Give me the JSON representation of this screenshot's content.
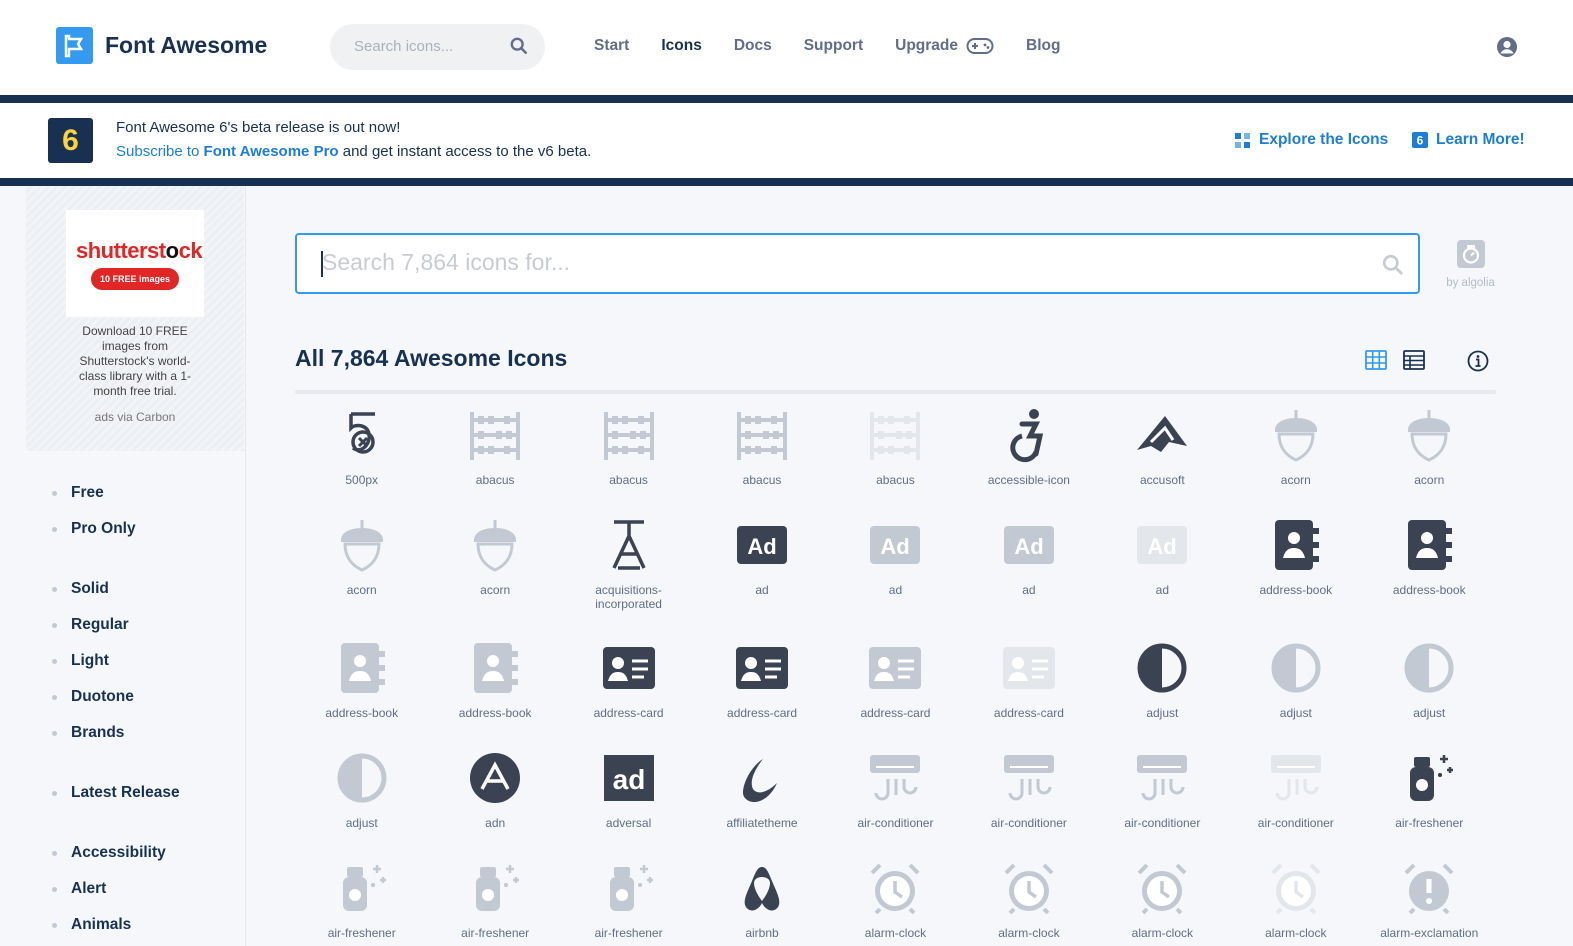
{
  "header": {
    "brand": "Font Awesome",
    "search_placeholder": "Search icons...",
    "nav": [
      "Start",
      "Icons",
      "Docs",
      "Support",
      "Upgrade",
      "Blog"
    ],
    "active_nav": "Icons"
  },
  "banner": {
    "badge": "6",
    "line1": "Font Awesome 6's beta release is out now!",
    "line2_link_a": "Subscribe to ",
    "line2_link_b": "Font Awesome Pro",
    "line2_rest": " and get instant access to the v6 beta.",
    "explore": "Explore the Icons",
    "learn": "Learn More!"
  },
  "ad": {
    "logo_a": "shutterst",
    "logo_b": "ck",
    "pill": "10 FREE images",
    "text": "Download 10 FREE images from Shutterstock's world-class library with a 1-month free trial.",
    "via": "ads via Carbon"
  },
  "filters": [
    "Free",
    "Pro Only",
    "Solid",
    "Regular",
    "Light",
    "Duotone",
    "Brands",
    "Latest Release",
    "Accessibility",
    "Alert",
    "Animals"
  ],
  "main": {
    "search_placeholder": "Search 7,864 icons for...",
    "algolia": "by algolia",
    "title": "All 7,864 Awesome Icons"
  },
  "icons": [
    {
      "label": "500px",
      "style": "dark"
    },
    {
      "label": "abacus",
      "style": "light"
    },
    {
      "label": "abacus",
      "style": "light"
    },
    {
      "label": "abacus",
      "style": "light"
    },
    {
      "label": "abacus",
      "style": "pale"
    },
    {
      "label": "accessible-icon",
      "style": "dark"
    },
    {
      "label": "accusoft",
      "style": "dark"
    },
    {
      "label": "acorn",
      "style": "light"
    },
    {
      "label": "acorn",
      "style": "light"
    },
    {
      "label": "acorn",
      "style": "light"
    },
    {
      "label": "acorn",
      "style": "light"
    },
    {
      "label": "acquisitions-incorporated",
      "style": "dark"
    },
    {
      "label": "ad",
      "style": "dark"
    },
    {
      "label": "ad",
      "style": "light"
    },
    {
      "label": "ad",
      "style": "light"
    },
    {
      "label": "ad",
      "style": "pale"
    },
    {
      "label": "address-book",
      "style": "dark"
    },
    {
      "label": "address-book",
      "style": "dark"
    },
    {
      "label": "address-book",
      "style": "light"
    },
    {
      "label": "address-book",
      "style": "light"
    },
    {
      "label": "address-card",
      "style": "dark"
    },
    {
      "label": "address-card",
      "style": "dark"
    },
    {
      "label": "address-card",
      "style": "light"
    },
    {
      "label": "address-card",
      "style": "pale"
    },
    {
      "label": "adjust",
      "style": "dark"
    },
    {
      "label": "adjust",
      "style": "light"
    },
    {
      "label": "adjust",
      "style": "light"
    },
    {
      "label": "adjust",
      "style": "light"
    },
    {
      "label": "adn",
      "style": "dark"
    },
    {
      "label": "adversal",
      "style": "dark"
    },
    {
      "label": "affiliatetheme",
      "style": "dark"
    },
    {
      "label": "air-conditioner",
      "style": "light"
    },
    {
      "label": "air-conditioner",
      "style": "light"
    },
    {
      "label": "air-conditioner",
      "style": "light"
    },
    {
      "label": "air-conditioner",
      "style": "pale"
    },
    {
      "label": "air-freshener",
      "style": "dark"
    },
    {
      "label": "air-freshener",
      "style": "light"
    },
    {
      "label": "air-freshener",
      "style": "light"
    },
    {
      "label": "air-freshener",
      "style": "light"
    },
    {
      "label": "airbnb",
      "style": "dark"
    },
    {
      "label": "alarm-clock",
      "style": "light"
    },
    {
      "label": "alarm-clock",
      "style": "light"
    },
    {
      "label": "alarm-clock",
      "style": "light"
    },
    {
      "label": "alarm-clock",
      "style": "pale"
    },
    {
      "label": "alarm-exclamation",
      "style": "light"
    }
  ]
}
